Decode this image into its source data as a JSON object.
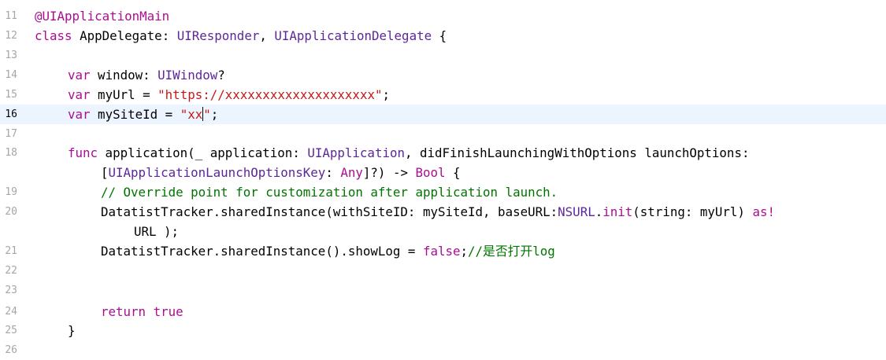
{
  "colors": {
    "keyword": "#aa0d91",
    "type": "#5c2699",
    "string": "#c41a16",
    "comment": "#007400",
    "plain": "#000000",
    "line_number": "#a6a6a6",
    "current_line_bg": "#ecf5ff"
  },
  "line_numbers": [
    "11",
    "12",
    "13",
    "14",
    "15",
    "16",
    "17",
    "18",
    "19",
    "20",
    "21",
    "22",
    "23",
    "24",
    "25",
    "26"
  ],
  "current_line": "16",
  "code": {
    "l11": {
      "attr": "@UIApplicationMain"
    },
    "l12": {
      "kw": "class",
      "name": " AppDelegate: ",
      "type1": "UIResponder",
      "sep": ", ",
      "type2": "UIApplicationDelegate",
      "brace": " {"
    },
    "l14": {
      "kw": "var",
      "name": " window: ",
      "type": "UIWindow",
      "opt": "?"
    },
    "l15": {
      "kw": "var",
      "name": " myUrl = ",
      "str": "\"https://xxxxxxxxxxxxxxxxxxxx\"",
      "semi": ";"
    },
    "l16": {
      "kw": "var",
      "name": " mySiteId = ",
      "str_before_caret": "\"xx",
      "str_after_caret": "\"",
      "semi": ";"
    },
    "l18": {
      "kw": "func",
      "name": " application(_ application: ",
      "type": "UIApplication",
      "rest": ", didFinishLaunchingWithOptions launchOptions:"
    },
    "l18b": {
      "open": "[",
      "type1": "UIApplicationLaunchOptionsKey",
      "colon": ": ",
      "type2": "Any",
      "mid": "]?) -> ",
      "type3": "Bool",
      "brace": " {"
    },
    "l19": {
      "comment": "// Override point for customization after application launch."
    },
    "l20": {
      "text": "DatatistTracker.sharedInstance(withSiteID: mySiteId, baseURL:",
      "type1": "NSURL",
      "dot": ".",
      "kw1": "init",
      "rest": "(string: myUrl) ",
      "kw2": "as!"
    },
    "l20b": {
      "text": "URL );"
    },
    "l21": {
      "text": "DatatistTracker.sharedInstance().showLog = ",
      "kw": "false",
      "semi": ";",
      "comment": "//是否打开log"
    },
    "l24": {
      "kw1": "return",
      "sp": " ",
      "kw2": "true"
    },
    "l25": {
      "brace": "}"
    }
  }
}
